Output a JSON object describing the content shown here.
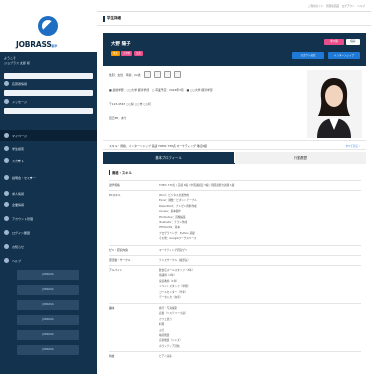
{
  "brand": {
    "logo_text": "JOBRASS",
    "logo_sub": "新卒"
  },
  "topbar": {
    "links": "ご利用ガイド　管理者画面　ログアウト　ヘルプ"
  },
  "page": {
    "title": "学生詳細"
  },
  "sidebar": {
    "user_line1": "ようこそ",
    "user_line2": "ジョブラス 太郎 様",
    "items": [
      {
        "label": "応募者情報",
        "top": 0
      },
      {
        "label": "メッセージ",
        "top": 0
      },
      {
        "label": "マイページ",
        "top": 0
      },
      {
        "label": "学生検索",
        "top": 0
      },
      {
        "label": "スカウト",
        "top": 0
      },
      {
        "label": "説明会・セミナー",
        "top": 0
      },
      {
        "label": "求人情報",
        "top": 0
      },
      {
        "label": "企業情報",
        "top": 0
      },
      {
        "label": "アカウント管理",
        "top": 0
      },
      {
        "label": "ログイン履歴",
        "top": 0
      },
      {
        "label": "お知らせ",
        "top": 0
      },
      {
        "label": "ヘルプ",
        "top": 0
      }
    ],
    "bottom_buttons": [
      "JOBRASS",
      "JOBRASS",
      "JOBRASS",
      "JOBRASS",
      "JOBRASS",
      "JOBRASS"
    ]
  },
  "candidate": {
    "name": "大野 陽子",
    "tags": [
      "男女",
      "大学院",
      "文系"
    ],
    "pink_label": "非公開",
    "white_label": "保存",
    "btn_left": "スカウト送信",
    "btn_right": "インターンシップ",
    "info_rows": [
      "性別：女性　年齢：22歳",
      "■ 最終学歴：○○大学 経済学部　○ 卒業予定：2024年3月　■ ○○大学 経済学部",
      "〒123-4567 ○○県 ○○市 ○○町",
      "自己PR：あり"
    ]
  },
  "skills": {
    "label": "スキル・資格：インターンシップ 英語 TOEIC 730点 マーケティング 簿記2級",
    "more": "すべて見る ›"
  },
  "tabs": {
    "active": "基本プロフィール",
    "inactive": "行動履歴"
  },
  "section": {
    "title": "資格・スキル"
  },
  "table": [
    {
      "k": "語学資格",
      "v": [
        "TOEIC 730点 / 英検 2級 / 中国語検定 3級 / 韓国語能力試験 1級"
      ]
    },
    {
      "k": "PCスキル",
      "v": [
        "Word：ビジネス文書作成",
        "Excel：関数・ピボットテーブル",
        "PowerPoint：プレゼン資料作成",
        "Access：基本操作",
        "Photoshop：画像編集",
        "Illustrator：チラシ作成",
        "HTML/CSS：基本",
        "プログラミング：Python 基礎",
        "その他：Googleワークスペース"
      ]
    },
    {
      "k": "ゼミ・研究内容",
      "v": [
        "マーケティング研究ゼミ"
      ]
    },
    {
      "k": "部活動・サークル",
      "v": [
        "テニスサークル（副部長）"
      ]
    },
    {
      "k": "アルバイト",
      "v": [
        "飲食店ホールスタッフ（3年）",
        "塾講師（2年）",
        "家庭教師（1年）",
        "イベントスタッフ（単発）",
        "コールセンター（半年）",
        "データ入力（在宅）"
      ]
    },
    {
      "k": "趣味",
      "v": [
        "旅行・写真撮影",
        "読書（ミステリー小説）",
        "カフェ巡り",
        "料理",
        "ヨガ",
        "映画鑑賞",
        "音楽鑑賞（ジャズ）",
        "ボランティア活動"
      ]
    },
    {
      "k": "特技",
      "v": [
        "ピアノ演奏"
      ]
    }
  ]
}
